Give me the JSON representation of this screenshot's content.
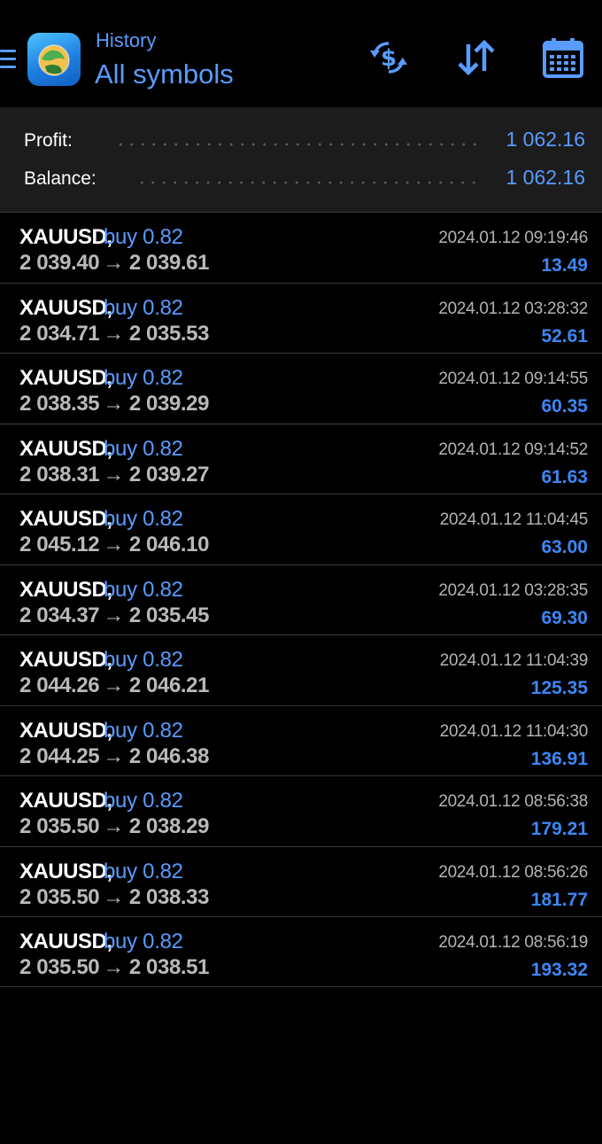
{
  "header": {
    "subtitle": "History",
    "title": "All symbols",
    "icons": [
      "menu-icon",
      "app-logo",
      "currency-exchange-icon",
      "sort-icon",
      "calendar-icon"
    ],
    "accent_color": "#5a9bff"
  },
  "summary": {
    "profit_label": "Profit:",
    "profit_value": "1 062.16",
    "balance_label": "Balance:",
    "balance_value": "1 062.16"
  },
  "deals": [
    {
      "symbol": "XAUUSD,",
      "type": "buy 0.82",
      "open": "2 039.40",
      "arrow": "→",
      "close": "2 039.61",
      "time": "2024.01.12 09:19:46",
      "profit": "13.49"
    },
    {
      "symbol": "XAUUSD,",
      "type": "buy 0.82",
      "open": "2 034.71",
      "arrow": "→",
      "close": "2 035.53",
      "time": "2024.01.12 03:28:32",
      "profit": "52.61"
    },
    {
      "symbol": "XAUUSD,",
      "type": "buy 0.82",
      "open": "2 038.35",
      "arrow": "→",
      "close": "2 039.29",
      "time": "2024.01.12 09:14:55",
      "profit": "60.35"
    },
    {
      "symbol": "XAUUSD,",
      "type": "buy 0.82",
      "open": "2 038.31",
      "arrow": "→",
      "close": "2 039.27",
      "time": "2024.01.12 09:14:52",
      "profit": "61.63"
    },
    {
      "symbol": "XAUUSD,",
      "type": "buy 0.82",
      "open": "2 045.12",
      "arrow": "→",
      "close": "2 046.10",
      "time": "2024.01.12 11:04:45",
      "profit": "63.00"
    },
    {
      "symbol": "XAUUSD,",
      "type": "buy 0.82",
      "open": "2 034.37",
      "arrow": "→",
      "close": "2 035.45",
      "time": "2024.01.12 03:28:35",
      "profit": "69.30"
    },
    {
      "symbol": "XAUUSD,",
      "type": "buy 0.82",
      "open": "2 044.26",
      "arrow": "→",
      "close": "2 046.21",
      "time": "2024.01.12 11:04:39",
      "profit": "125.35"
    },
    {
      "symbol": "XAUUSD,",
      "type": "buy 0.82",
      "open": "2 044.25",
      "arrow": "→",
      "close": "2 046.38",
      "time": "2024.01.12 11:04:30",
      "profit": "136.91"
    },
    {
      "symbol": "XAUUSD,",
      "type": "buy 0.82",
      "open": "2 035.50",
      "arrow": "→",
      "close": "2 038.29",
      "time": "2024.01.12 08:56:38",
      "profit": "179.21"
    },
    {
      "symbol": "XAUUSD,",
      "type": "buy 0.82",
      "open": "2 035.50",
      "arrow": "→",
      "close": "2 038.33",
      "time": "2024.01.12 08:56:26",
      "profit": "181.77"
    },
    {
      "symbol": "XAUUSD,",
      "type": "buy 0.82",
      "open": "2 035.50",
      "arrow": "→",
      "close": "2 038.51",
      "time": "2024.01.12 08:56:19",
      "profit": "193.32"
    }
  ]
}
